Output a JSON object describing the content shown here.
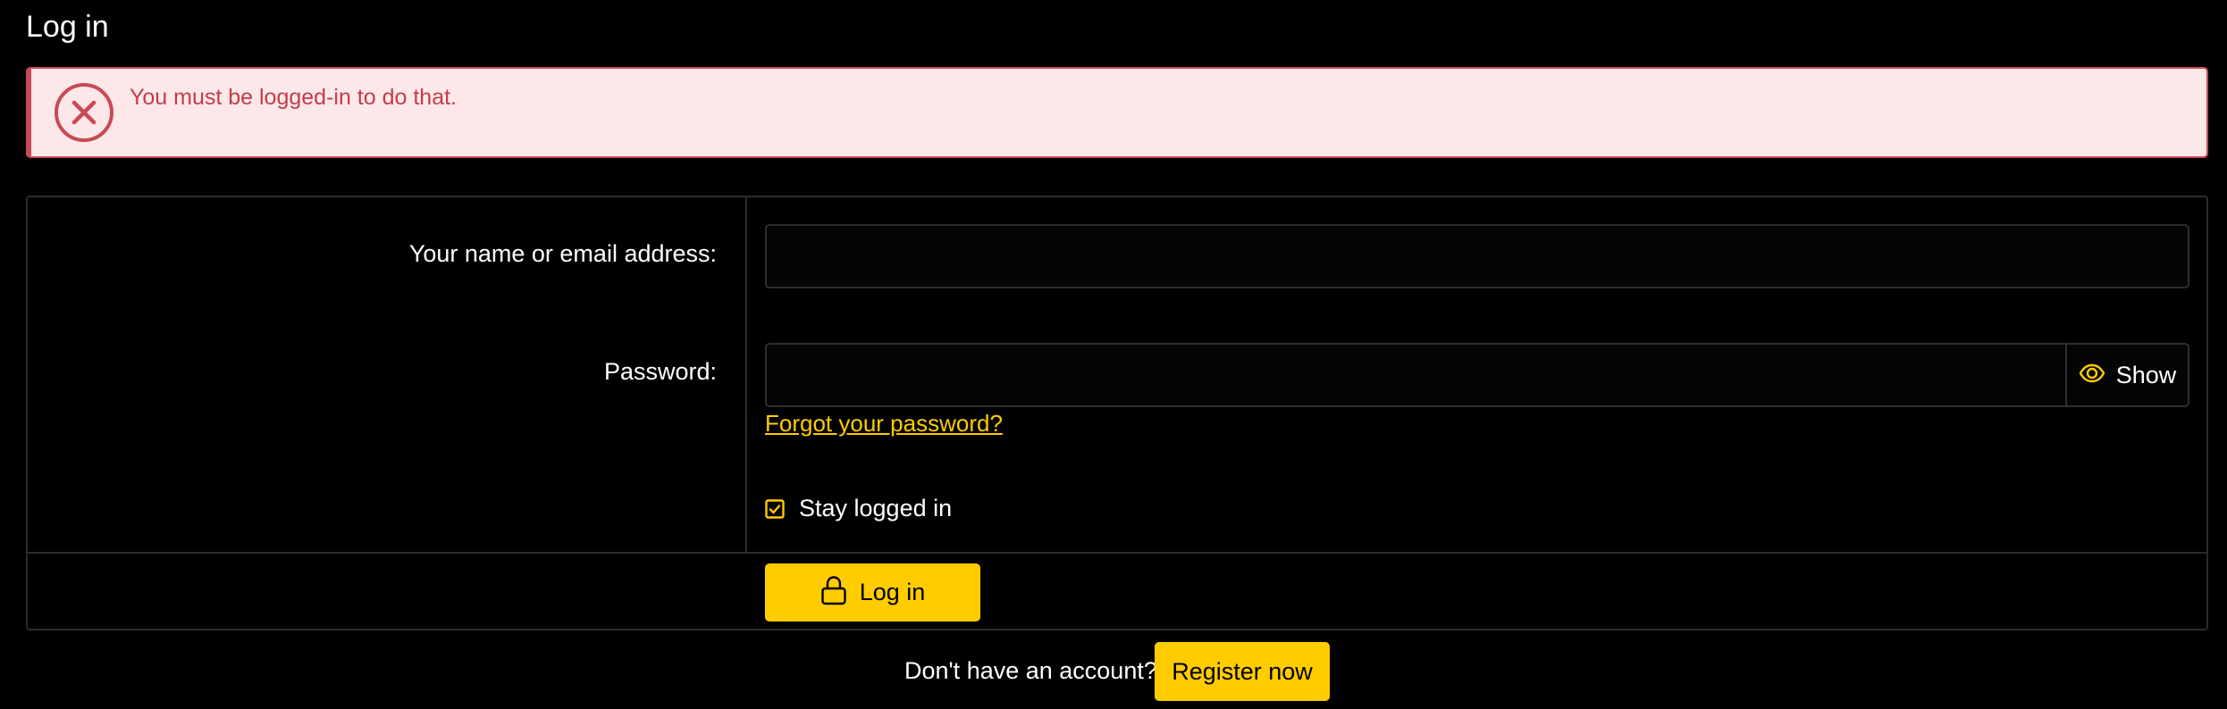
{
  "page": {
    "title": "Log in"
  },
  "alert": {
    "icon": "error-circle-x-icon",
    "message": "You must be logged-in to do that.",
    "color": "#c84a55",
    "background": "#fde8e9"
  },
  "form": {
    "name_label": "Your name or email address:",
    "name_value": "",
    "password_label": "Password:",
    "password_value": "",
    "show_password": {
      "icon": "eye-icon",
      "label": "Show"
    },
    "forgot_password": "Forgot your password?",
    "stay_logged_in": {
      "label": "Stay logged in",
      "checked": true,
      "icon": "checkbox-checked-icon"
    },
    "submit": {
      "icon": "lock-icon",
      "label": "Log in"
    }
  },
  "register": {
    "prompt": "Don't have an account?",
    "button": "Register now"
  },
  "colors": {
    "accent": "#ffcc00",
    "background": "#000000",
    "text": "#ffffff",
    "border": "#2b2b2b"
  }
}
